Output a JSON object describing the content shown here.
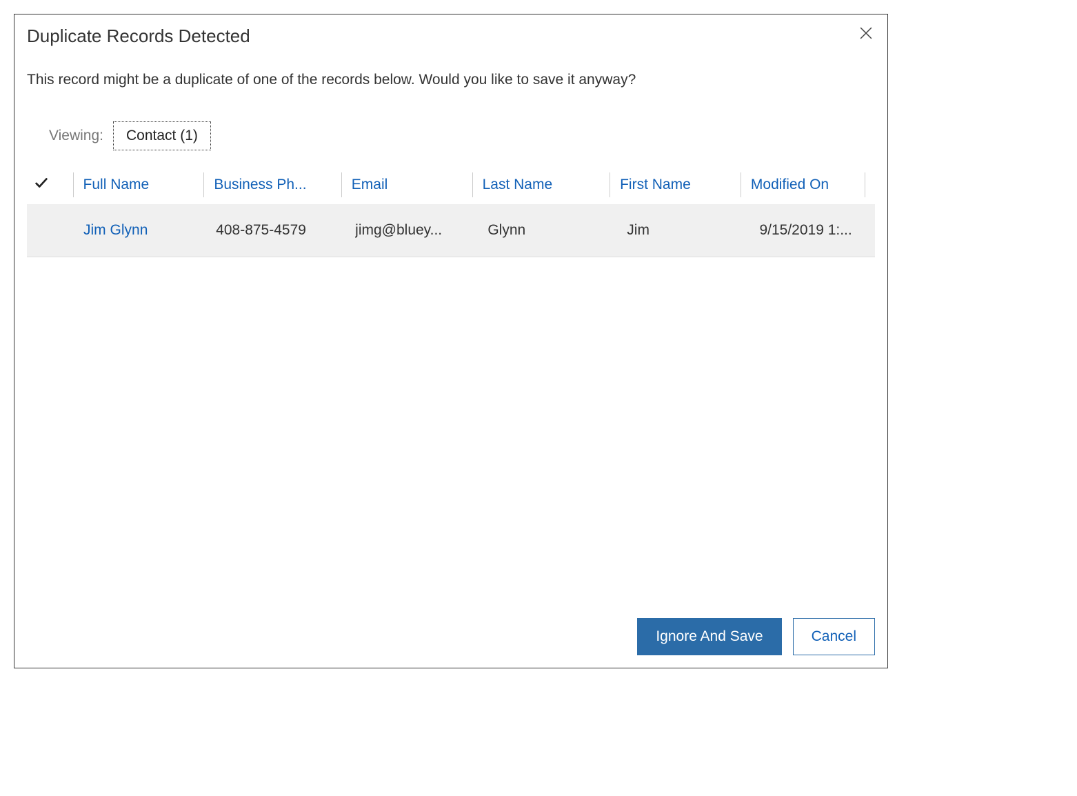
{
  "dialog": {
    "title": "Duplicate Records Detected",
    "message": "This record might be a duplicate of one of the records below. Would you like to save it anyway?"
  },
  "viewing": {
    "label": "Viewing:",
    "typeLabel": "Contact (1)"
  },
  "columns": {
    "fullName": "Full Name",
    "businessPhone": "Business Ph...",
    "email": "Email",
    "lastName": "Last Name",
    "firstName": "First Name",
    "modifiedOn": "Modified On"
  },
  "rows": [
    {
      "fullName": "Jim Glynn",
      "businessPhone": "408-875-4579",
      "email": "jimg@bluey...",
      "lastName": "Glynn",
      "firstName": "Jim",
      "modifiedOn": "9/15/2019 1:..."
    }
  ],
  "buttons": {
    "primary": "Ignore And Save",
    "secondary": "Cancel"
  }
}
